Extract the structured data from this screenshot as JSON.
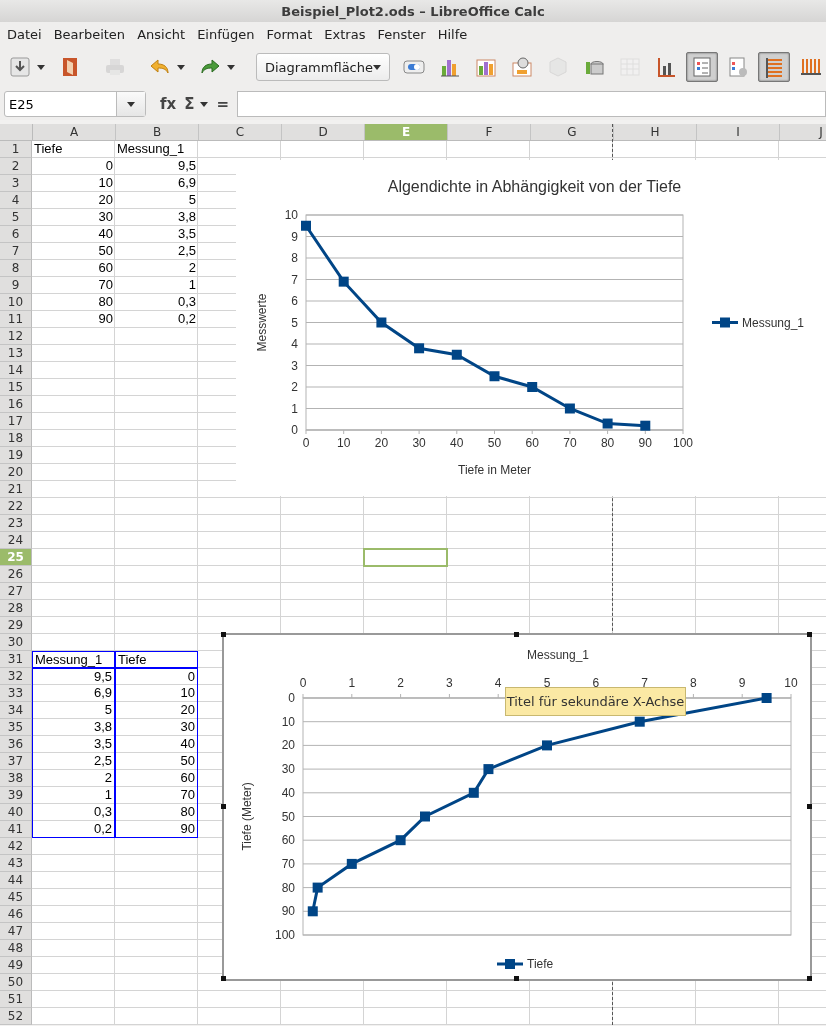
{
  "window": {
    "title": "Beispiel_Plot2.ods – LibreOffice Calc"
  },
  "menu": [
    "Datei",
    "Bearbeiten",
    "Ansicht",
    "Einfügen",
    "Format",
    "Extras",
    "Fenster",
    "Hilfe"
  ],
  "toolbar": {
    "buttons": [
      {
        "pressed": false,
        "disabled": false,
        "has_menu": true
      },
      {
        "pressed": false,
        "disabled": false,
        "has_menu": false
      },
      {
        "pressed": false,
        "disabled": true,
        "has_menu": false
      },
      {
        "pressed": false,
        "disabled": false,
        "has_menu": true
      },
      {
        "pressed": false,
        "disabled": false,
        "has_menu": true
      }
    ],
    "element_select": {
      "value": "Diagrammfläche"
    },
    "chart_buttons": [
      {
        "pressed": false,
        "disabled": false
      },
      {
        "pressed": false,
        "disabled": false
      },
      {
        "pressed": false,
        "disabled": false
      },
      {
        "pressed": false,
        "disabled": false
      },
      {
        "pressed": false,
        "disabled": true
      },
      {
        "pressed": false,
        "disabled": false
      },
      {
        "pressed": false,
        "disabled": true
      },
      {
        "pressed": false,
        "disabled": false
      },
      {
        "pressed": true,
        "disabled": false
      },
      {
        "pressed": false,
        "disabled": false
      },
      {
        "pressed": true,
        "disabled": false
      },
      {
        "pressed": false,
        "disabled": false
      }
    ]
  },
  "formula_bar": {
    "name_box": "E25",
    "function_wizard": "fx",
    "sum": "Σ",
    "equals": "="
  },
  "sheet": {
    "columns": [
      {
        "label": "A",
        "selected": false
      },
      {
        "label": "B",
        "selected": false
      },
      {
        "label": "C",
        "selected": false
      },
      {
        "label": "D",
        "selected": false
      },
      {
        "label": "E",
        "selected": true
      },
      {
        "label": "F",
        "selected": false
      },
      {
        "label": "G",
        "selected": false
      },
      {
        "label": "H",
        "selected": false
      },
      {
        "label": "I",
        "selected": false
      },
      {
        "label": "J",
        "selected": false
      }
    ],
    "rows": [
      {
        "label": "1",
        "selected": false,
        "marked": false,
        "kind": "text",
        "cells": [
          "Tiefe",
          "Messung_1"
        ]
      },
      {
        "label": "2",
        "selected": false,
        "marked": false,
        "kind": "number",
        "cells": [
          "0",
          "9,5"
        ]
      },
      {
        "label": "3",
        "selected": false,
        "marked": false,
        "kind": "number",
        "cells": [
          "10",
          "6,9"
        ]
      },
      {
        "label": "4",
        "selected": false,
        "marked": false,
        "kind": "number",
        "cells": [
          "20",
          "5"
        ]
      },
      {
        "label": "5",
        "selected": false,
        "marked": false,
        "kind": "number",
        "cells": [
          "30",
          "3,8"
        ]
      },
      {
        "label": "6",
        "selected": false,
        "marked": false,
        "kind": "number",
        "cells": [
          "40",
          "3,5"
        ]
      },
      {
        "label": "7",
        "selected": false,
        "marked": false,
        "kind": "number",
        "cells": [
          "50",
          "2,5"
        ]
      },
      {
        "label": "8",
        "selected": false,
        "marked": false,
        "kind": "number",
        "cells": [
          "60",
          "2"
        ]
      },
      {
        "label": "9",
        "selected": false,
        "marked": false,
        "kind": "number",
        "cells": [
          "70",
          "1"
        ]
      },
      {
        "label": "10",
        "selected": false,
        "marked": false,
        "kind": "number",
        "cells": [
          "80",
          "0,3"
        ]
      },
      {
        "label": "11",
        "selected": false,
        "marked": false,
        "kind": "number",
        "cells": [
          "90",
          "0,2"
        ]
      },
      {
        "label": "12",
        "selected": false
      },
      {
        "label": "13",
        "selected": false
      },
      {
        "label": "14",
        "selected": false
      },
      {
        "label": "15",
        "selected": false
      },
      {
        "label": "16",
        "selected": false
      },
      {
        "label": "17",
        "selected": false
      },
      {
        "label": "18",
        "selected": false
      },
      {
        "label": "19",
        "selected": false
      },
      {
        "label": "20",
        "selected": false
      },
      {
        "label": "21",
        "selected": false
      },
      {
        "label": "22",
        "selected": false
      },
      {
        "label": "23",
        "selected": false
      },
      {
        "label": "24",
        "selected": false
      },
      {
        "label": "25",
        "selected": true
      },
      {
        "label": "26",
        "selected": false
      },
      {
        "label": "27",
        "selected": false
      },
      {
        "label": "28",
        "selected": false
      },
      {
        "label": "29",
        "selected": false
      },
      {
        "label": "30",
        "selected": false
      },
      {
        "label": "31",
        "selected": false,
        "marked": true,
        "kind": "text",
        "cells": [
          "Messung_1",
          "Tiefe"
        ]
      },
      {
        "label": "32",
        "selected": false,
        "marked": true,
        "kind": "number",
        "cells": [
          "9,5",
          "0"
        ]
      },
      {
        "label": "33",
        "selected": false,
        "marked": true,
        "kind": "number",
        "cells": [
          "6,9",
          "10"
        ]
      },
      {
        "label": "34",
        "selected": false,
        "marked": true,
        "kind": "number",
        "cells": [
          "5",
          "20"
        ]
      },
      {
        "label": "35",
        "selected": false,
        "marked": true,
        "kind": "number",
        "cells": [
          "3,8",
          "30"
        ]
      },
      {
        "label": "36",
        "selected": false,
        "marked": true,
        "kind": "number",
        "cells": [
          "3,5",
          "40"
        ]
      },
      {
        "label": "37",
        "selected": false,
        "marked": true,
        "kind": "number",
        "cells": [
          "2,5",
          "50"
        ]
      },
      {
        "label": "38",
        "selected": false,
        "marked": true,
        "kind": "number",
        "cells": [
          "2",
          "60"
        ]
      },
      {
        "label": "39",
        "selected": false,
        "marked": true,
        "kind": "number",
        "cells": [
          "1",
          "70"
        ]
      },
      {
        "label": "40",
        "selected": false,
        "marked": true,
        "kind": "number",
        "cells": [
          "0,3",
          "80"
        ]
      },
      {
        "label": "41",
        "selected": false,
        "marked": true,
        "kind": "number",
        "cells": [
          "0,2",
          "90"
        ]
      },
      {
        "label": "42",
        "selected": false
      },
      {
        "label": "43",
        "selected": false
      },
      {
        "label": "44",
        "selected": false
      },
      {
        "label": "45",
        "selected": false
      },
      {
        "label": "46",
        "selected": false
      },
      {
        "label": "47",
        "selected": false
      },
      {
        "label": "48",
        "selected": false
      },
      {
        "label": "49",
        "selected": false
      },
      {
        "label": "50",
        "selected": false
      },
      {
        "label": "51",
        "selected": false
      },
      {
        "label": "52",
        "selected": false
      }
    ]
  },
  "charts": [
    {
      "selected": false,
      "x_axis_on_top": false,
      "legend_at_right": true,
      "chart_data": {
        "type": "line",
        "title": "Algendichte in Abhängigkeit von der Tiefe",
        "xlabel": "Tiefe in Meter",
        "ylabel": "Messwerte",
        "x": [
          0,
          10,
          20,
          30,
          40,
          50,
          60,
          70,
          80,
          90
        ],
        "grid": true,
        "series": [
          {
            "name": "Messung_1",
            "color": "#004586",
            "marker": "square",
            "values": [
              9.5,
              6.9,
              5,
              3.8,
              3.5,
              2.5,
              2,
              1,
              0.3,
              0.2
            ]
          }
        ],
        "xlim": [
          0,
          100
        ],
        "ylim": [
          0,
          10
        ],
        "xticks": [
          0,
          10,
          20,
          30,
          40,
          50,
          60,
          70,
          80,
          90,
          100
        ],
        "yticks": [
          0,
          1,
          2,
          3,
          4,
          5,
          6,
          7,
          8,
          9,
          10
        ]
      }
    },
    {
      "selected": true,
      "tooltip": "Titel für sekundäre X-Achse",
      "x_axis_on_top": true,
      "legend_at_right": false,
      "chart_data": {
        "type": "line",
        "xlabel": "Messung_1",
        "ylabel": "Tiefe (Meter)",
        "x": [
          9.5,
          6.9,
          5,
          3.8,
          3.5,
          2.5,
          2,
          1,
          0.3,
          0.2
        ],
        "grid": true,
        "series": [
          {
            "name": "Tiefe",
            "color": "#004586",
            "marker": "square",
            "values": [
              0,
              10,
              20,
              30,
              40,
              50,
              60,
              70,
              80,
              90
            ]
          }
        ],
        "xlim": [
          0,
          10
        ],
        "ylim": [
          100,
          0
        ],
        "xticks": [
          0,
          1,
          2,
          3,
          4,
          5,
          6,
          7,
          8,
          9,
          10
        ],
        "yticks": [
          0,
          10,
          20,
          30,
          40,
          50,
          60,
          70,
          80,
          90,
          100
        ]
      }
    }
  ]
}
